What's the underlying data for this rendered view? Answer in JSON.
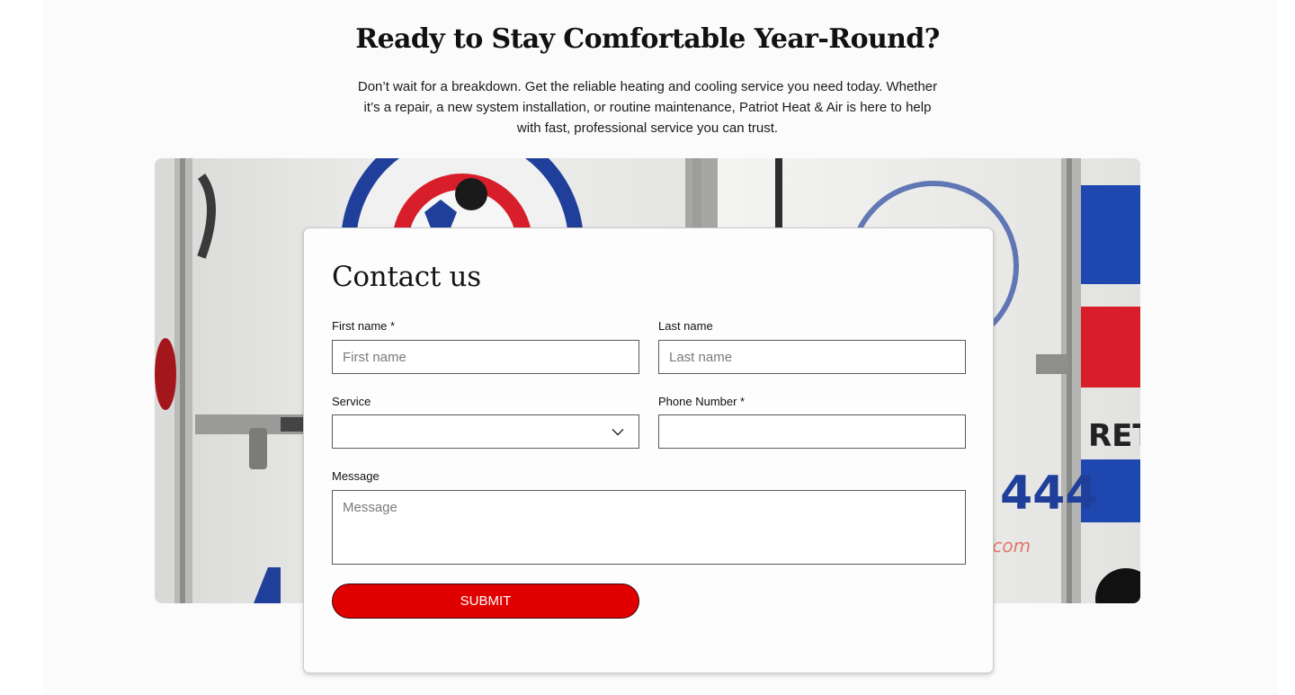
{
  "section": {
    "headline": "Ready to Stay Comfortable Year-Round?",
    "intro": "Don’t wait for a breakdown. Get the reliable heating and cooling service you need today. Whether it’s a repair, a new system installation, or routine maintenance, Patriot Heat & Air is here to help with fast, professional service you can trust."
  },
  "hero_image": {
    "description_icon": "service-vans-photo",
    "visible_text": [
      "444",
      "RETR",
      ".com"
    ]
  },
  "form": {
    "title": "Contact us",
    "first_name": {
      "label": "First name *",
      "placeholder": "First name",
      "value": ""
    },
    "last_name": {
      "label": "Last name",
      "placeholder": "Last name",
      "value": ""
    },
    "service": {
      "label": "Service",
      "selected": "",
      "icon": "chevron-down-icon"
    },
    "phone": {
      "label": "Phone Number *",
      "placeholder": "",
      "value": ""
    },
    "message": {
      "label": "Message",
      "placeholder": "Message",
      "value": ""
    },
    "submit_label": "SUBMIT"
  },
  "colors": {
    "submit_bg": "#e10000",
    "brand_red": "#d81e2a",
    "brand_blue": "#1f3f9a"
  }
}
